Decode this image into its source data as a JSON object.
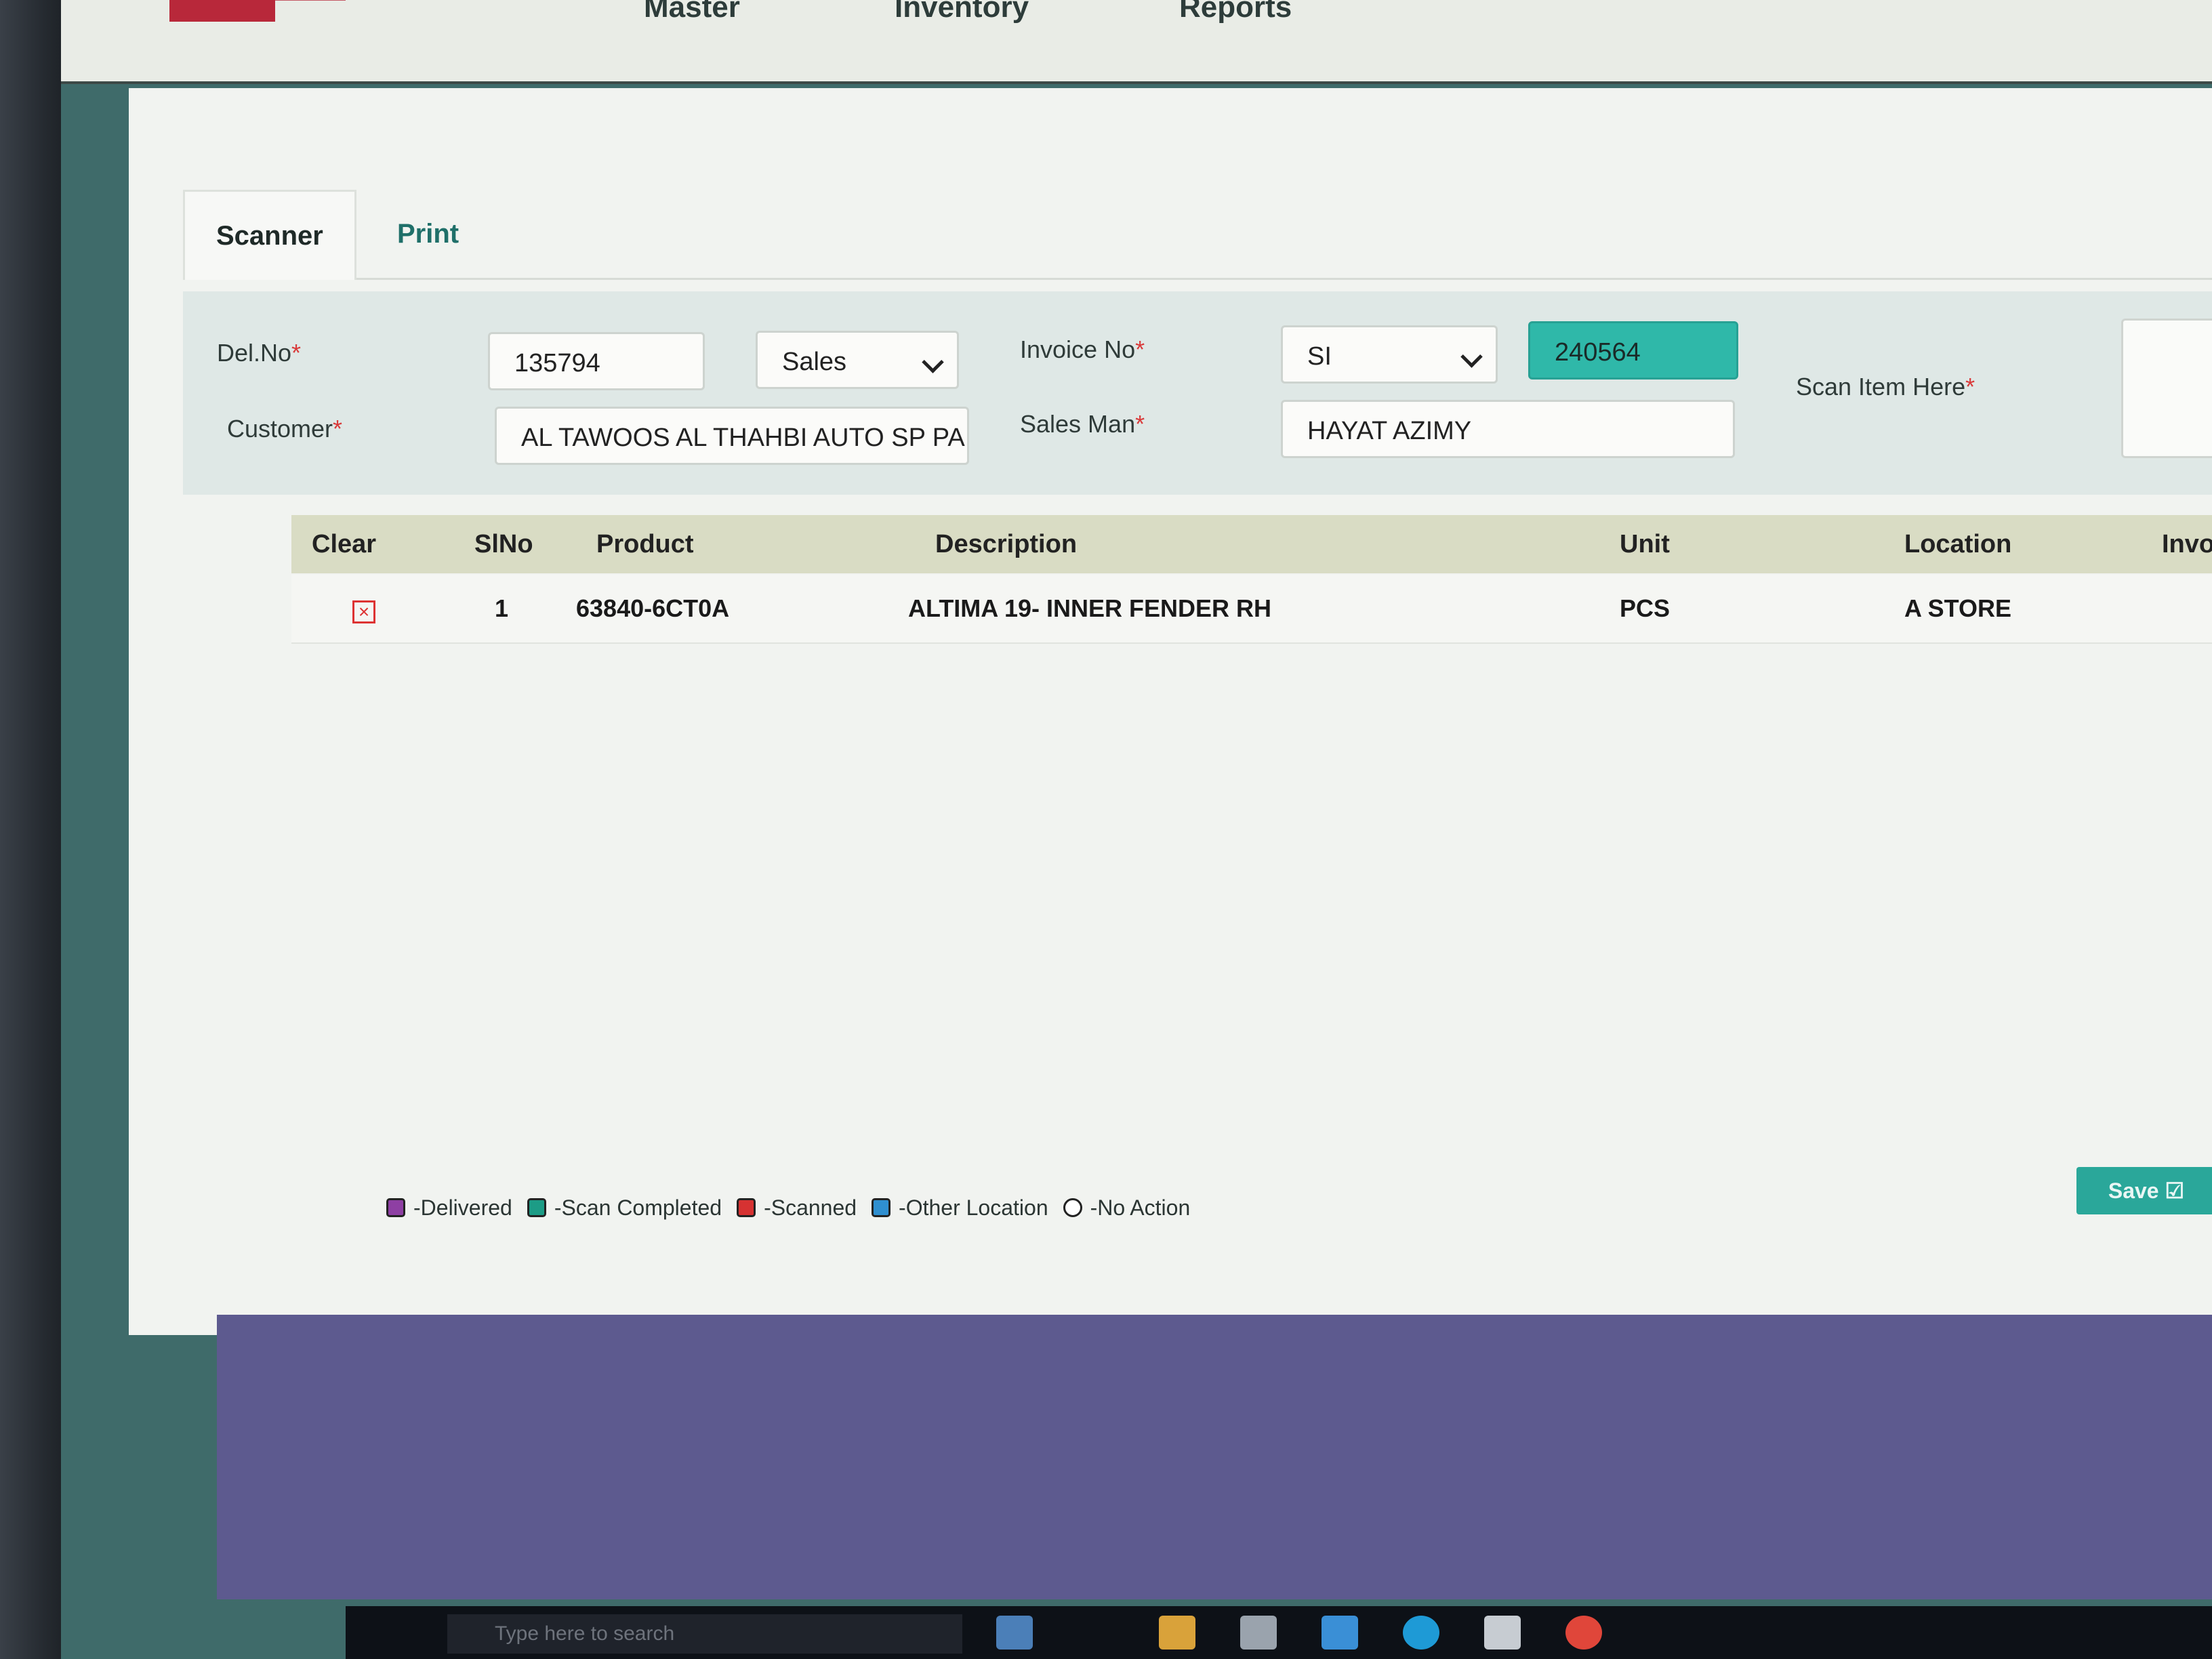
{
  "topbar": {
    "nav_items": [
      "Master",
      "Inventory",
      "Reports"
    ]
  },
  "tabs": [
    {
      "label": "Scanner"
    },
    {
      "label": "Print"
    }
  ],
  "form": {
    "del_no_label": "Del.No",
    "del_no_value": "135794",
    "type_value": "Sales",
    "invoice_no_label": "Invoice No",
    "invoice_prefix_value": "SI",
    "invoice_no_value": "240564",
    "scan_label": "Scan Item Here",
    "customer_label": "Customer",
    "customer_value": "AL TAWOOS AL THAHBI AUTO SP PA",
    "salesman_label": "Sales Man",
    "salesman_value": "HAYAT AZIMY",
    "required_mark": "*"
  },
  "grid": {
    "headers": [
      "Clear",
      "SlNo",
      "Product",
      "Description",
      "Unit",
      "Location",
      "Invoice Q"
    ],
    "rows": [
      {
        "slno": "1",
        "product": "63840-6CT0A",
        "description": "ALTIMA 19- INNER FENDER RH",
        "unit": "PCS",
        "location": "A STORE"
      }
    ]
  },
  "legend": [
    {
      "label": "-Delivered",
      "color": "#8e3fa3"
    },
    {
      "label": "-Scan Completed",
      "color": "#1c9c86"
    },
    {
      "label": "-Scanned",
      "color": "#d63232"
    },
    {
      "label": "-Other Location",
      "color": "#2f8fd0"
    },
    {
      "label": "-No Action",
      "color": "#ffffff"
    }
  ],
  "actions": {
    "save_label": "Save"
  },
  "taskbar": {
    "search_placeholder": "Type here to search"
  },
  "colors": {
    "accent": "#2aa79a",
    "header_bg": "#d9dcc4",
    "form_bg": "#dfe8e6"
  }
}
